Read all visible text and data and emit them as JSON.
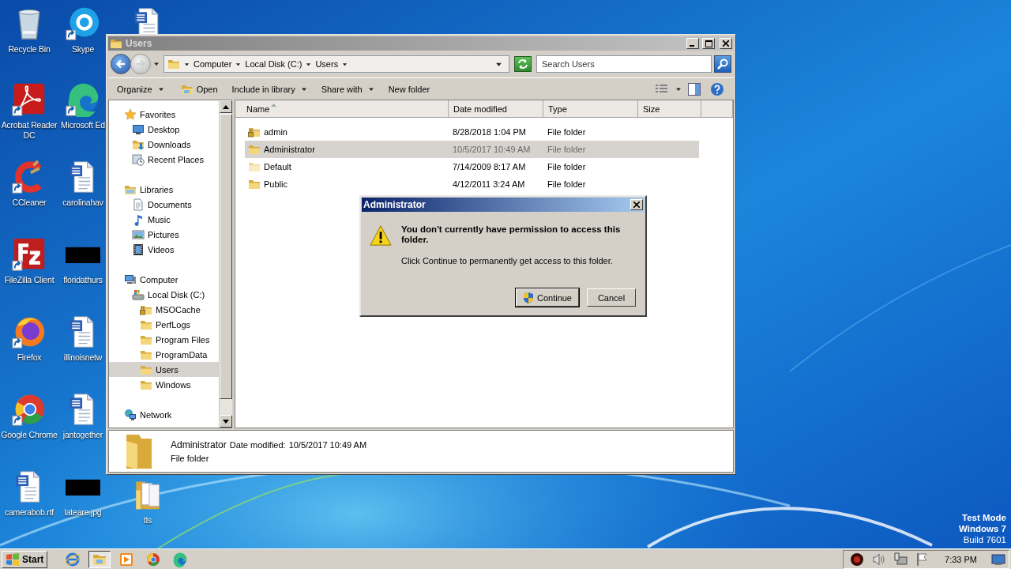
{
  "desktop": {
    "icons": [
      {
        "label": "Recycle Bin",
        "kind": "recycle",
        "shortcut": false
      },
      {
        "label": "Acrobat Reader DC",
        "kind": "acrobat",
        "shortcut": true
      },
      {
        "label": "CCleaner",
        "kind": "ccleaner",
        "shortcut": true
      },
      {
        "label": "FileZilla Client",
        "kind": "filezilla",
        "shortcut": true
      },
      {
        "label": "Firefox",
        "kind": "firefox",
        "shortcut": true
      },
      {
        "label": "Google Chrome",
        "kind": "chrome",
        "shortcut": true
      },
      {
        "label": "camerabob.rtf",
        "kind": "word",
        "shortcut": false
      },
      {
        "label": "Skype",
        "kind": "skype",
        "shortcut": true
      },
      {
        "label": "Microsoft Ed",
        "kind": "edge",
        "shortcut": true
      },
      {
        "label": "carolinahav",
        "kind": "word",
        "shortcut": false
      },
      {
        "label": "floridathurs",
        "kind": "thumb",
        "shortcut": false
      },
      {
        "label": "illinoisnetw",
        "kind": "word",
        "shortcut": false
      },
      {
        "label": "jantogether",
        "kind": "word",
        "shortcut": false
      },
      {
        "label": "lateare.jpg",
        "kind": "thumb",
        "shortcut": false
      },
      {
        "kind": "word",
        "shortcut": false
      },
      {
        "label": "tls",
        "kind": "docfolder",
        "shortcut": false
      }
    ],
    "test_mode_notice": [
      "Test Mode",
      "Windows 7",
      "Build 7601"
    ]
  },
  "window": {
    "title": "Users",
    "address": {
      "crumbs": [
        "Computer",
        "Local Disk (C:)",
        "Users"
      ]
    },
    "search": {
      "placeholder": "Search Users"
    },
    "toolbar": [
      {
        "label": "Organize",
        "kind": "plain",
        "dropdown": true
      },
      {
        "label": "Open",
        "kind": "open",
        "dropdown": false
      },
      {
        "label": "Include in library",
        "kind": "plain",
        "dropdown": true
      },
      {
        "label": "Share with",
        "kind": "plain",
        "dropdown": true
      },
      {
        "label": "New folder",
        "kind": "plain",
        "dropdown": false
      }
    ],
    "nav": [
      {
        "label": "Favorites",
        "kind": "star",
        "selected": false,
        "children": [
          {
            "label": "Desktop",
            "kind": "desktop",
            "selected": false
          },
          {
            "label": "Downloads",
            "kind": "downloads",
            "selected": false
          },
          {
            "label": "Recent Places",
            "kind": "recent",
            "selected": false
          }
        ]
      },
      {
        "label": "Libraries",
        "kind": "libraries",
        "selected": false,
        "children": [
          {
            "label": "Documents",
            "kind": "documents",
            "selected": false
          },
          {
            "label": "Music",
            "kind": "music",
            "selected": false
          },
          {
            "label": "Pictures",
            "kind": "pictures",
            "selected": false
          },
          {
            "label": "Videos",
            "kind": "videos",
            "selected": false
          }
        ]
      },
      {
        "label": "Computer",
        "kind": "computer",
        "selected": false,
        "children": [
          {
            "label": "Local Disk (C:)",
            "kind": "drive",
            "selected": false,
            "children": [
              {
                "label": "MSOCache",
                "kind": "folder-locked",
                "selected": false
              },
              {
                "label": "PerfLogs",
                "kind": "folder",
                "selected": false
              },
              {
                "label": "Program Files",
                "kind": "folder",
                "selected": false
              },
              {
                "label": "ProgramData",
                "kind": "folder",
                "selected": false
              },
              {
                "label": "Users",
                "kind": "folder",
                "selected": true
              },
              {
                "label": "Windows",
                "kind": "folder",
                "selected": false
              }
            ]
          }
        ]
      },
      {
        "label": "Network",
        "kind": "network",
        "selected": false
      }
    ],
    "columns": [
      {
        "label": "Name",
        "sorted": true
      },
      {
        "label": "Date modified",
        "sorted": false
      },
      {
        "label": "Type",
        "sorted": false
      },
      {
        "label": "Size",
        "sorted": false
      }
    ],
    "rows": [
      {
        "name": "admin",
        "date": "8/28/2018 1:04 PM",
        "type": "File folder",
        "kind": "folder-locked",
        "selected": false
      },
      {
        "name": "Administrator",
        "date": "10/5/2017 10:49 AM",
        "type": "File folder",
        "kind": "folder",
        "selected": true
      },
      {
        "name": "Default",
        "date": "7/14/2009 8:17 AM",
        "type": "File folder",
        "kind": "folder-hidden",
        "selected": false
      },
      {
        "name": "Public",
        "date": "4/12/2011 3:24 AM",
        "type": "File folder",
        "kind": "folder",
        "selected": false
      }
    ],
    "details": {
      "name": "Administrator",
      "date_label": "Date modified:",
      "date": "10/5/2017 10:49 AM",
      "type": "File folder"
    }
  },
  "dialog": {
    "title": "Administrator",
    "heading": "You don't currently have permission to access this folder.",
    "message": "Click Continue to permanently get access to this folder.",
    "buttons": [
      {
        "label": "Continue",
        "default": true,
        "shield": true
      },
      {
        "label": "Cancel",
        "default": false,
        "shield": false
      }
    ]
  },
  "taskbar": {
    "start": "Start",
    "apps": [
      {
        "kind": "ie",
        "active": false
      },
      {
        "kind": "explorer",
        "active": true
      },
      {
        "kind": "media",
        "active": false
      },
      {
        "kind": "chrome-small",
        "active": false
      },
      {
        "kind": "edge-small",
        "active": false
      }
    ],
    "clock": "7:33 PM"
  }
}
